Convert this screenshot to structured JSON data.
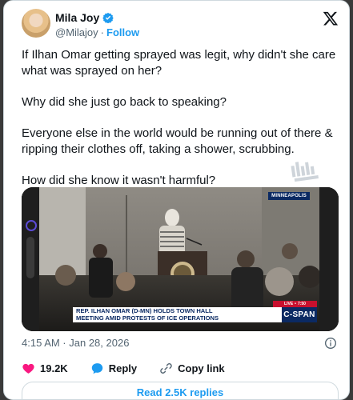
{
  "author": {
    "name": "Mila Joy",
    "handle": "@Milajoy",
    "separator": "·",
    "follow_label": "Follow",
    "verified_color": "#1d9bf0"
  },
  "tweet": {
    "paragraphs": [
      "If Ilhan Omar getting sprayed was legit, why didn't she care what was sprayed on her?",
      "Why did she just go back to speaking?",
      "Everyone else in the world would be running out of there & ripping their clothes off, taking a shower, scrubbing.",
      "How did she know it wasn't harmful?"
    ]
  },
  "media": {
    "location_tag": "MINNEAPOLIS",
    "chyron_line1": "REP. ILHAN OMAR (D-MN) HOLDS TOWN HALL",
    "chyron_line2": "MEETING AMID PROTESTS OF ICE OPERATIONS",
    "network": "C-SPAN",
    "live_label": "LIVE",
    "live_time": "7:50"
  },
  "meta": {
    "timestamp": "4:15 AM · Jan 28, 2026"
  },
  "actions": {
    "likes": "19.2K",
    "reply_label": "Reply",
    "copy_label": "Copy link"
  },
  "footer": {
    "read_replies": "Read 2.5K replies"
  },
  "colors": {
    "accent": "#1d9bf0",
    "like": "#f91880",
    "text": "#0f1419",
    "muted": "#536471"
  },
  "icons": [
    "verified-badge-icon",
    "x-logo-icon",
    "info-icon",
    "heart-icon",
    "reply-icon",
    "link-icon"
  ]
}
